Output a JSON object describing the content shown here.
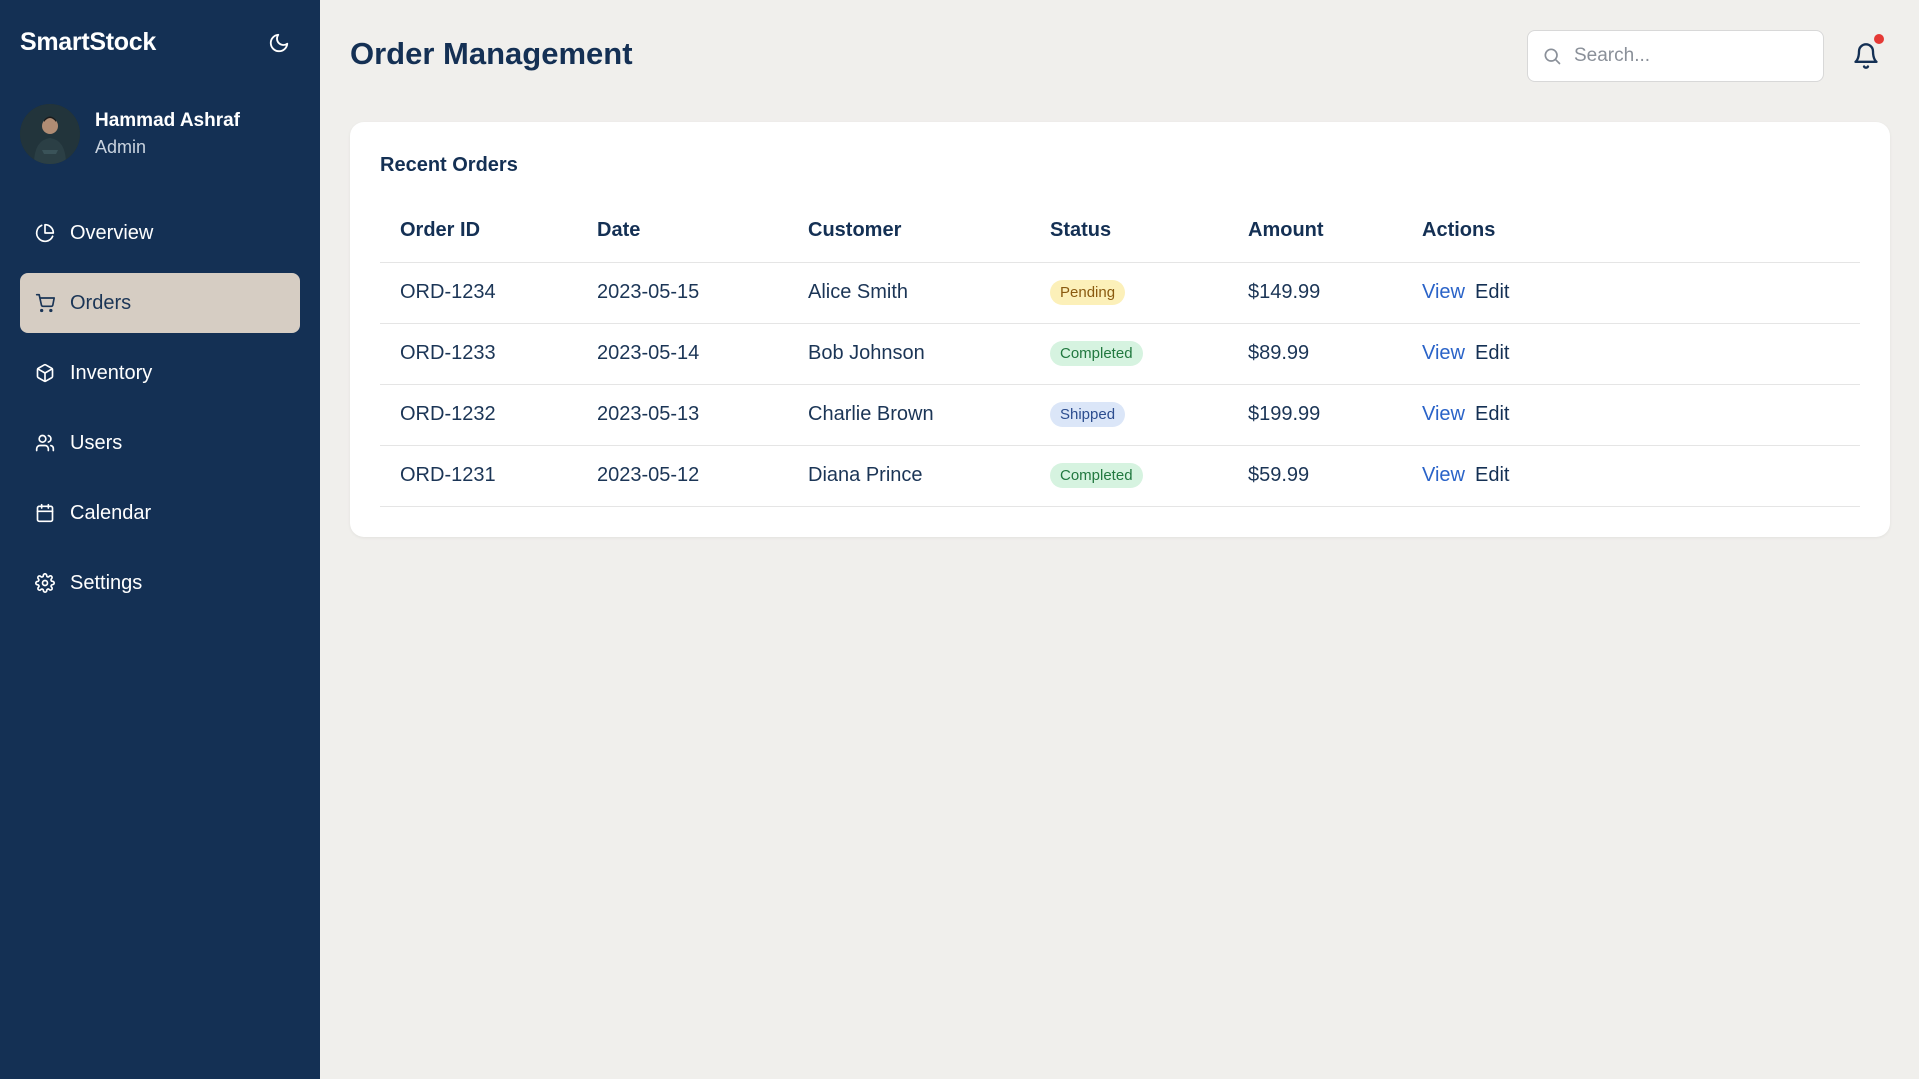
{
  "sidebar": {
    "brand": "SmartStock",
    "theme_icon": "moon-icon",
    "user": {
      "name": "Hammad Ashraf",
      "role": "Admin"
    },
    "items": [
      {
        "label": "Overview",
        "icon": "pie-chart-icon",
        "active": false
      },
      {
        "label": "Orders",
        "icon": "cart-icon",
        "active": true
      },
      {
        "label": "Inventory",
        "icon": "box-icon",
        "active": false
      },
      {
        "label": "Users",
        "icon": "users-icon",
        "active": false
      },
      {
        "label": "Calendar",
        "icon": "calendar-icon",
        "active": false
      },
      {
        "label": "Settings",
        "icon": "gear-icon",
        "active": false
      }
    ]
  },
  "header": {
    "title": "Order Management",
    "search_placeholder": "Search...",
    "notification_icon": "bell-icon",
    "has_notification": true
  },
  "orders": {
    "title": "Recent Orders",
    "columns": [
      "Order ID",
      "Date",
      "Customer",
      "Status",
      "Amount",
      "Actions"
    ],
    "rows": [
      {
        "id": "ORD-1234",
        "date": "2023-05-15",
        "customer": "Alice Smith",
        "status": "Pending",
        "amount": "$149.99",
        "view": "View",
        "edit": "Edit"
      },
      {
        "id": "ORD-1233",
        "date": "2023-05-14",
        "customer": "Bob Johnson",
        "status": "Completed",
        "amount": "$89.99",
        "view": "View",
        "edit": "Edit"
      },
      {
        "id": "ORD-1232",
        "date": "2023-05-13",
        "customer": "Charlie Brown",
        "status": "Shipped",
        "amount": "$199.99",
        "view": "View",
        "edit": "Edit"
      },
      {
        "id": "ORD-1231",
        "date": "2023-05-12",
        "customer": "Diana Prince",
        "status": "Completed",
        "amount": "$59.99",
        "view": "View",
        "edit": "Edit"
      }
    ]
  },
  "colors": {
    "sidebar_bg": "#143054",
    "active_nav_bg": "#d6cdc3",
    "page_bg": "#f0efec",
    "link": "#2a63c8",
    "notification_dot": "#e53935"
  }
}
